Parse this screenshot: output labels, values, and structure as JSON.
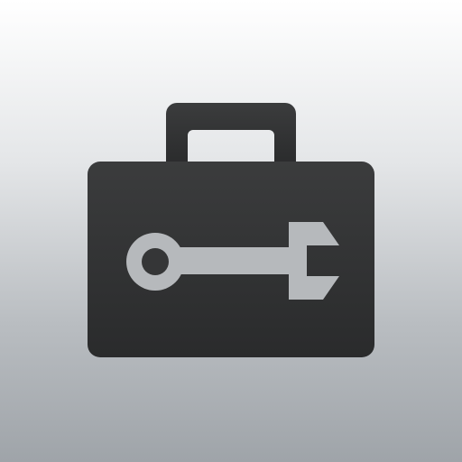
{
  "icon": {
    "name": "toolbox-icon",
    "colors": {
      "background_top": "#ffffff",
      "background_bottom": "#9fa4a9",
      "case_top": "#3b3c3d",
      "case_bottom": "#2a2b2c",
      "wrench": "#b6b9bc",
      "wrench_hole": "#353637"
    },
    "elements": [
      "toolbox-body",
      "toolbox-handle",
      "wrench-icon"
    ]
  }
}
